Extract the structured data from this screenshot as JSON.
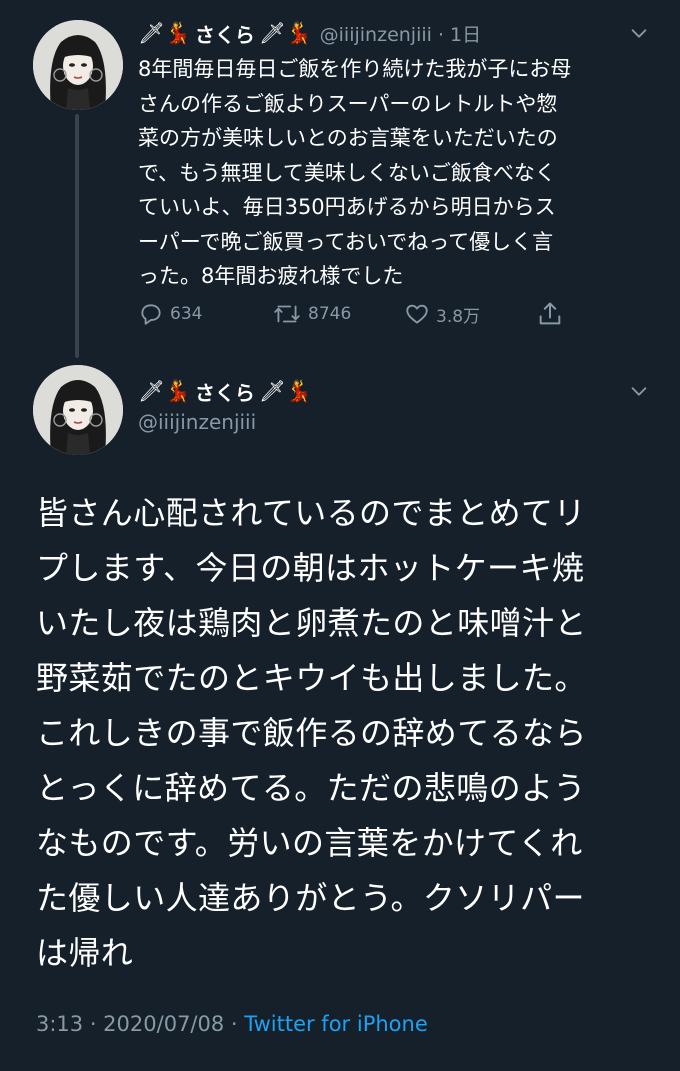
{
  "colors": {
    "background": "#15202b",
    "text_primary": "#ffffff",
    "text_secondary": "#8899a6",
    "link": "#1da1f2",
    "thread_line": "#38444d"
  },
  "tweet1": {
    "name_prefix_icons": [
      "dagger-icon",
      "dancer-icon"
    ],
    "name": "さくら",
    "name_suffix_icons": [
      "dagger-icon",
      "dancer-icon"
    ],
    "handle_time": "@iiijinzenjiii · 1日",
    "body": "8年間毎日毎日ご飯を作り続けた我が子にお母\nさんの作るご飯よりスーパーのレトルトや惣\n菜の方が美味しいとのお言葉をいただいたの\nで、もう無理して美味しくないご飯食べなく\nていいよ、毎日350円あげるから明日からス\nーパーで晩ご飯買っておいでねって優しく言\nった。8年間お疲れ様でした",
    "actions": {
      "reply_count": "634",
      "retweet_count": "8746",
      "like_count": "3.8万"
    }
  },
  "tweet2": {
    "name": "さくら",
    "handle": "@iiijinzenjiii",
    "body": "皆さん心配されているのでまとめてリ\nプします、今日の朝はホットケーキ焼\nいたし夜は鶏肉と卵煮たのと味噌汁と\n野菜茹でたのとキウイも出しました。\nこれしきの事で飯作るの辞めてるなら\nとっくに辞めてる。ただの悲鳴のよう\nなものです。労いの言葉をかけてくれ\nた優しい人達ありがとう。クソリパー\nは帰れ",
    "timestamp": "3:13 · 2020/07/08 · ",
    "source": "Twitter for iPhone"
  },
  "emoji": {
    "dagger": "🗡",
    "dancer": "💃"
  }
}
